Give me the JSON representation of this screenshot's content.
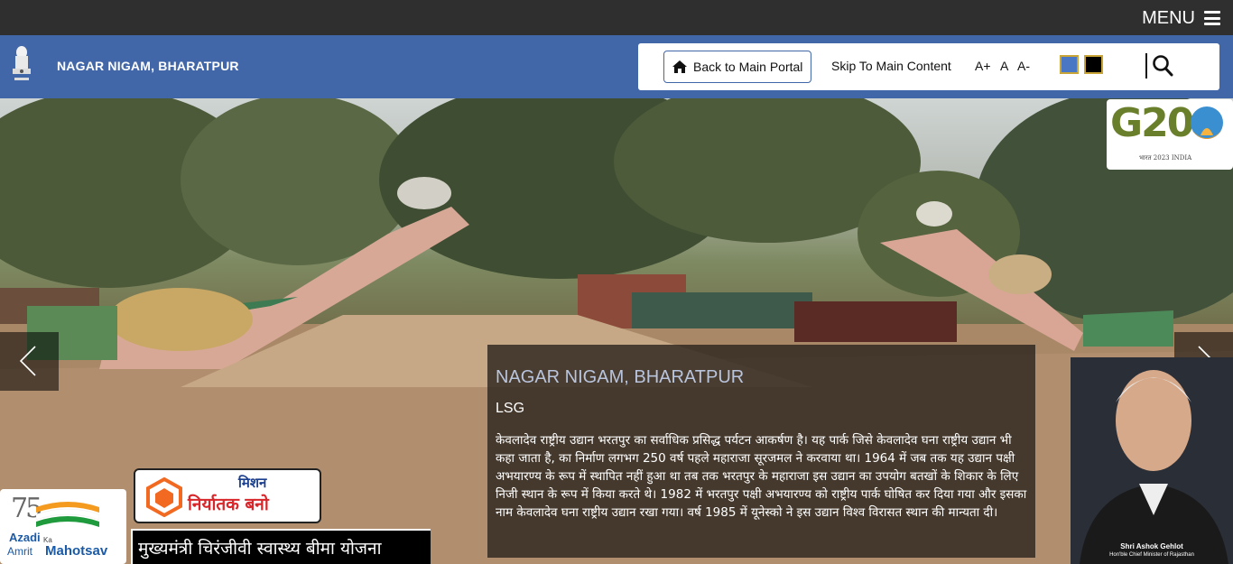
{
  "topbar": {
    "menu_label": "MENU",
    "menu_icon": "hamburger-icon"
  },
  "header": {
    "emblem_icon": "state-emblem-icon",
    "site_title": "NAGAR NIGAM, BHARATPUR",
    "brand_color": "#4267a8"
  },
  "toolbox": {
    "back_label": "Back to Main Portal",
    "back_icon": "home-icon",
    "skip_label": "Skip To Main Content",
    "font_increase": "A+",
    "font_normal": "A",
    "font_decrease": "A-",
    "themes": [
      {
        "name": "blue-theme",
        "color": "#4a77c4"
      },
      {
        "name": "dark-theme",
        "color": "#000000"
      }
    ],
    "search_icon": "search-icon"
  },
  "slider": {
    "prev_icon": "chevron-left-icon",
    "next_icon": "chevron-right-icon",
    "caption": {
      "title": "NAGAR NIGAM, BHARATPUR",
      "subtitle": "LSG",
      "body": "केवलादेव राष्ट्रीय उद्यान भरतपुर का सर्वाधिक प्रसिद्ध पर्यटन आकर्षण है। यह पार्क जिसे केवलादेव घना राष्ट्रीय उद्यान भी कहा जाता है, का निर्माण लगभग 250 वर्ष पहले महाराजा सूरजमल ने करवाया था। 1964 में जब तक यह उद्यान पक्षी अभयारण्य के रूप में स्थापित नहीं हुआ था तब तक भरतपुर के महाराजा इस उद्यान का उपयोग बतखों के शिकार के लिए निजी स्थान के रूप में किया करते थे। 1982 में भरतपुर पक्षी अभयारण्य को राष्ट्रीय पार्क घोषित कर दिया गया और इसका नाम केवलादेव घना राष्ट्रीय उद्यान रखा गया। वर्ष 1985 में यूनेस्को ने इस उद्यान विश्व विरासत स्थान की मान्यता दी।"
    }
  },
  "g20": {
    "logo_text": "G20",
    "subtext": "भारत 2023 INDIA"
  },
  "cm": {
    "name": "Shri Ashok Gehlot",
    "role": "Hon'ble Chief Minister of Rajasthan"
  },
  "azadi": {
    "number": "75",
    "line1": "Azadi",
    "ka": "Ka",
    "line2": "Amrit",
    "line3": "Mahotsav"
  },
  "mission": {
    "line1": "मिशन",
    "line2": "निर्यातक बनो"
  },
  "scheme": {
    "label": "मुख्यमंत्री चिरंजीवी स्वास्थ्य बीमा योजना"
  }
}
